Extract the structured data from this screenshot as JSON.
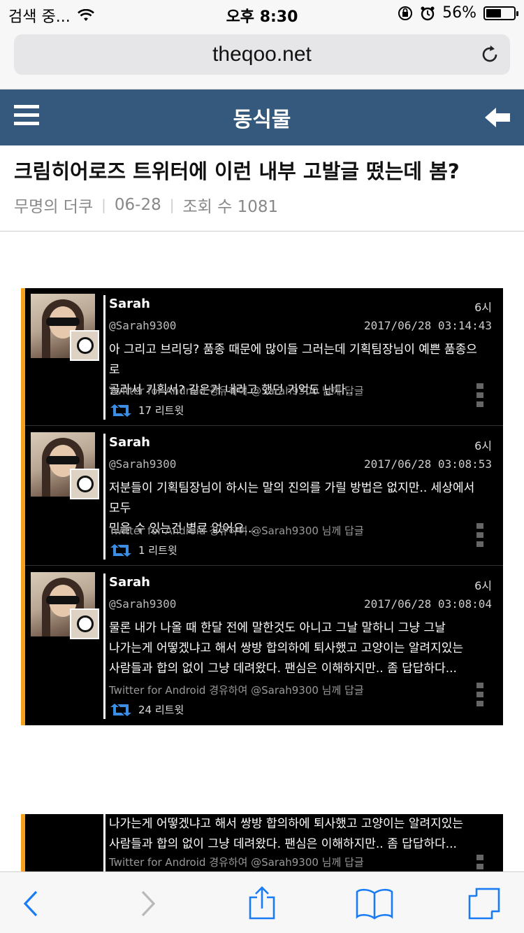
{
  "status_bar": {
    "carrier": "검색 중...",
    "time": "오후 8:30",
    "battery_percent": "56%",
    "battery_level": 0.56
  },
  "address_bar": {
    "url": "theqoo.net"
  },
  "site_header": {
    "title": "동식물",
    "brand_color": "#34597c"
  },
  "post": {
    "title": "크림히어로즈 트위터에 이런 내부 고발글 떴는데 봄?",
    "author": "무명의 더쿠",
    "date": "06-28",
    "views": "조회 수 1081"
  },
  "tweets": [
    {
      "name": "Sarah",
      "relative_time": "6시",
      "handle": "@Sarah9300",
      "datetime": "2017/06/28 03:14:43",
      "lines": [
        "아 그리고 브리딩? 품종 때문에 많이들 그러는데 기획팀장님이 예쁜 품종으로",
        "골라서 기획서? 같은거 내라고 했던 기억도 난다.."
      ],
      "source": "Twitter for Android 경유하여 @Sarah9300 님께 답글",
      "retweets": "17 리트윗"
    },
    {
      "name": "Sarah",
      "relative_time": "6시",
      "handle": "@Sarah9300",
      "datetime": "2017/06/28 03:08:53",
      "lines": [
        "저분들이 기획팀장님이 하시는 말의 진의를 가릴 방법은 없지만.. 세상에서 모두",
        "믿을 수 있는건 별로 없어요..."
      ],
      "source": "Twitter for Android 경유하여 @Sarah9300 님께 답글",
      "retweets": "1 리트윗"
    },
    {
      "name": "Sarah",
      "relative_time": "6시",
      "handle": "@Sarah9300",
      "datetime": "2017/06/28 03:08:04",
      "lines": [
        "물론 내가 나올 때 한달 전에 말한것도 아니고 그날 말하니 그냥 그날",
        "나가는게 어떻겠냐고 해서 쌍방 합의하에 퇴사했고 고양이는 알려지있는",
        "사람들과 합의 없이 그냥 데려왔다. 팬심은 이해하지만.. 좀 답답하다..."
      ],
      "source": "Twitter for Android 경유하여 @Sarah9300 님께 답글",
      "retweets": "24 리트윗"
    }
  ],
  "partial_tweet": {
    "lines": [
      "나가는게 어떻겠냐고 해서 쌍방 합의하에 퇴사했고 고양이는 알려지있는",
      "사람들과 합의 없이 그냥 데려왔다. 팬심은 이해하지만.. 좀 답답하다..."
    ],
    "source": "Twitter for Android 경유하여 @Sarah9300 님께 답글"
  },
  "toolbar": {
    "icons": [
      "back-icon",
      "forward-icon",
      "share-icon",
      "bookmarks-icon",
      "tabs-icon"
    ],
    "accent": "#1a7cf5"
  }
}
